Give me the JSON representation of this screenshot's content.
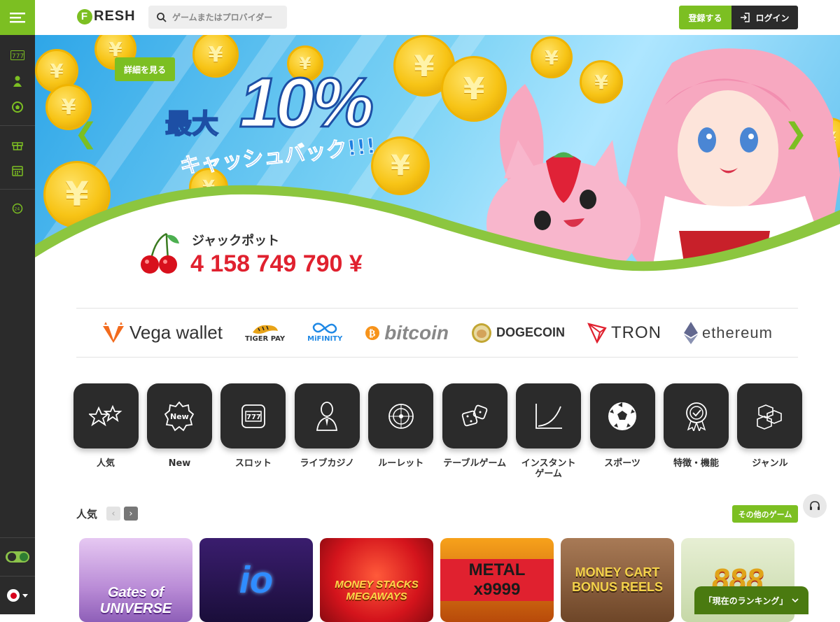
{
  "brand": {
    "logo_letter": "F",
    "logo_text": "RESH",
    "accent": "#7cbf22",
    "dark": "#2b2b2b"
  },
  "sidebar": {
    "items": [
      {
        "icon": "slot-machine-icon"
      },
      {
        "icon": "casino-chip-icon"
      },
      {
        "icon": "soccer-ball-icon"
      },
      {
        "icon": "gift-icon"
      },
      {
        "icon": "calendar-icon"
      },
      {
        "icon": "support-24-icon"
      }
    ],
    "theme_toggle": "light",
    "language_flag": "jp"
  },
  "header": {
    "search_placeholder": "ゲームまたはプロバイダー",
    "register_label": "登録する",
    "login_label": "ログイン"
  },
  "banner": {
    "details_label": "詳細を見る",
    "promo_prefix": "最大",
    "promo_value": "10%",
    "promo_subtitle": "キャッシュバック!!!",
    "jackpot_label": "ジャックポット",
    "jackpot_value": "4 158 749 790 ¥"
  },
  "payments": [
    "Vega wallet",
    "TIGER PAY",
    "MiFINITY",
    "bitcoin",
    "DOGECOIN",
    "TRON",
    "ethereum"
  ],
  "categories": [
    {
      "label": "人気",
      "icon": "stars-icon"
    },
    {
      "label": "New",
      "icon": "new-badge-icon"
    },
    {
      "label": "スロット",
      "icon": "slot-machine-icon"
    },
    {
      "label": "ライブカジノ",
      "icon": "live-dealer-icon"
    },
    {
      "label": "ルーレット",
      "icon": "roulette-icon"
    },
    {
      "label": "テーブルゲーム",
      "icon": "dice-icon"
    },
    {
      "label": "インスタント\nゲーム",
      "icon": "crash-graph-icon"
    },
    {
      "label": "スポーツ",
      "icon": "soccer-ball-icon"
    },
    {
      "label": "特徴・機能",
      "icon": "feature-medal-icon"
    },
    {
      "label": "ジャンル",
      "icon": "cubes-icon"
    }
  ],
  "popular": {
    "title": "人気",
    "more_label": "その他のゲーム",
    "games": [
      {
        "title": "Gates of UNIVERSE",
        "bg": "#c9a3e0"
      },
      {
        "title": "io",
        "bg": "#2a1850"
      },
      {
        "title": "MONEY STACKS MEGAWAYS",
        "bg": "#d4141c"
      },
      {
        "title": "METAL x9999",
        "bg": "#e07a10"
      },
      {
        "title": "MONEY CART BONUS REELS",
        "bg": "#8a5a3a"
      },
      {
        "title": "888",
        "bg": "#d8e4c0"
      }
    ]
  },
  "ranking_label": "「現在のランキング」"
}
